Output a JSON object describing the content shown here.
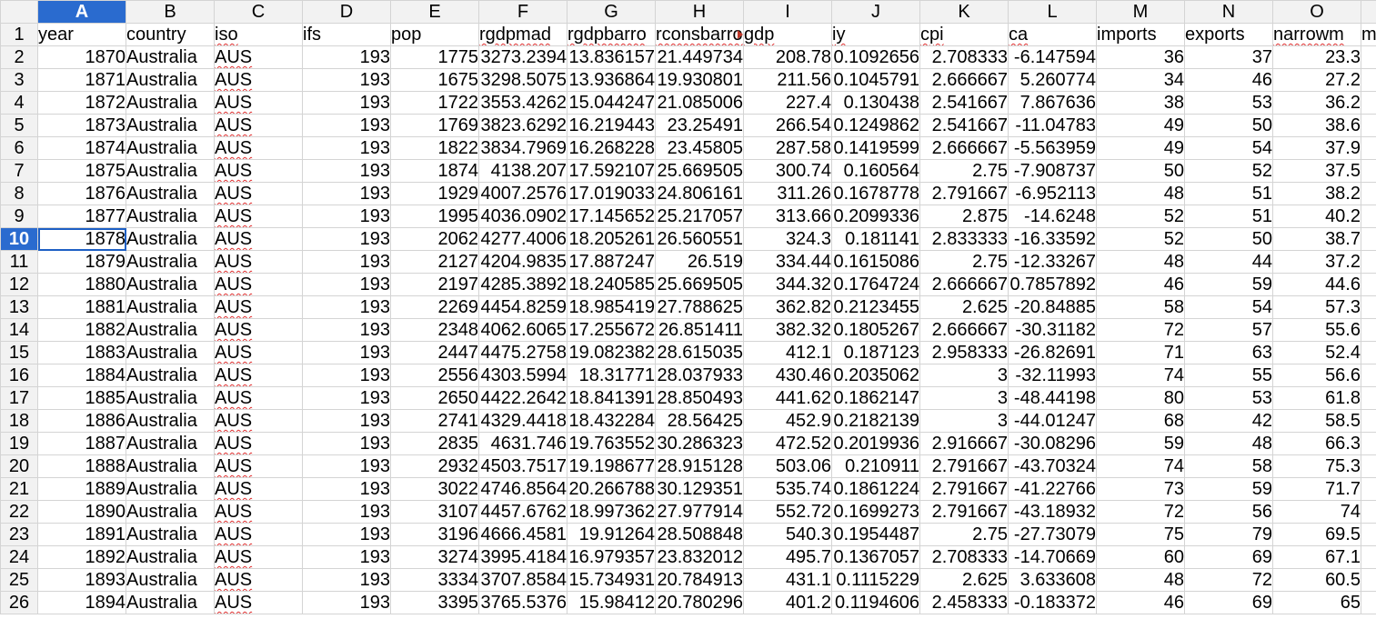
{
  "column_letters": [
    "A",
    "B",
    "C",
    "D",
    "E",
    "F",
    "G",
    "H",
    "I",
    "J",
    "K",
    "L",
    "M",
    "N",
    "O",
    ""
  ],
  "active_column": "A",
  "active_row": 10,
  "header_row": [
    "year",
    "country",
    "iso",
    "ifs",
    "pop",
    "rgdpmad",
    "rgdpbarro",
    "rconsbarro",
    "gdp",
    "iy",
    "cpi",
    "ca",
    "imports",
    "exports",
    "narrowm",
    "m"
  ],
  "rows": [
    [
      "1870",
      "Australia",
      "AUS",
      "193",
      "1775",
      "3273.2394",
      "13.836157",
      "21.449734",
      "208.78",
      "0.1092656",
      "2.708333",
      "-6.147594",
      "36",
      "37",
      "23.3"
    ],
    [
      "1871",
      "Australia",
      "AUS",
      "193",
      "1675",
      "3298.5075",
      "13.936864",
      "19.930801",
      "211.56",
      "0.1045791",
      "2.666667",
      "5.260774",
      "34",
      "46",
      "27.2"
    ],
    [
      "1872",
      "Australia",
      "AUS",
      "193",
      "1722",
      "3553.4262",
      "15.044247",
      "21.085006",
      "227.4",
      "0.130438",
      "2.541667",
      "7.867636",
      "38",
      "53",
      "36.2"
    ],
    [
      "1873",
      "Australia",
      "AUS",
      "193",
      "1769",
      "3823.6292",
      "16.219443",
      "23.25491",
      "266.54",
      "0.1249862",
      "2.541667",
      "-11.04783",
      "49",
      "50",
      "38.6"
    ],
    [
      "1874",
      "Australia",
      "AUS",
      "193",
      "1822",
      "3834.7969",
      "16.268228",
      "23.45805",
      "287.58",
      "0.1419599",
      "2.666667",
      "-5.563959",
      "49",
      "54",
      "37.9"
    ],
    [
      "1875",
      "Australia",
      "AUS",
      "193",
      "1874",
      "4138.207",
      "17.592107",
      "25.669505",
      "300.74",
      "0.160564",
      "2.75",
      "-7.908737",
      "50",
      "52",
      "37.5"
    ],
    [
      "1876",
      "Australia",
      "AUS",
      "193",
      "1929",
      "4007.2576",
      "17.019033",
      "24.806161",
      "311.26",
      "0.1678778",
      "2.791667",
      "-6.952113",
      "48",
      "51",
      "38.2"
    ],
    [
      "1877",
      "Australia",
      "AUS",
      "193",
      "1995",
      "4036.0902",
      "17.145652",
      "25.217057",
      "313.66",
      "0.2099336",
      "2.875",
      "-14.6248",
      "52",
      "51",
      "40.2"
    ],
    [
      "1878",
      "Australia",
      "AUS",
      "193",
      "2062",
      "4277.4006",
      "18.205261",
      "26.560551",
      "324.3",
      "0.181141",
      "2.833333",
      "-16.33592",
      "52",
      "50",
      "38.7"
    ],
    [
      "1879",
      "Australia",
      "AUS",
      "193",
      "2127",
      "4204.9835",
      "17.887247",
      "26.519",
      "334.44",
      "0.1615086",
      "2.75",
      "-12.33267",
      "48",
      "44",
      "37.2"
    ],
    [
      "1880",
      "Australia",
      "AUS",
      "193",
      "2197",
      "4285.3892",
      "18.240585",
      "25.669505",
      "344.32",
      "0.1764724",
      "2.666667",
      "0.7857892",
      "46",
      "59",
      "44.6"
    ],
    [
      "1881",
      "Australia",
      "AUS",
      "193",
      "2269",
      "4454.8259",
      "18.985419",
      "27.788625",
      "362.82",
      "0.2123455",
      "2.625",
      "-20.84885",
      "58",
      "54",
      "57.3"
    ],
    [
      "1882",
      "Australia",
      "AUS",
      "193",
      "2348",
      "4062.6065",
      "17.255672",
      "26.851411",
      "382.32",
      "0.1805267",
      "2.666667",
      "-30.31182",
      "72",
      "57",
      "55.6"
    ],
    [
      "1883",
      "Australia",
      "AUS",
      "193",
      "2447",
      "4475.2758",
      "19.082382",
      "28.615035",
      "412.1",
      "0.187123",
      "2.958333",
      "-26.82691",
      "71",
      "63",
      "52.4"
    ],
    [
      "1884",
      "Australia",
      "AUS",
      "193",
      "2556",
      "4303.5994",
      "18.31771",
      "28.037933",
      "430.46",
      "0.2035062",
      "3",
      "-32.11993",
      "74",
      "55",
      "56.6"
    ],
    [
      "1885",
      "Australia",
      "AUS",
      "193",
      "2650",
      "4422.2642",
      "18.841391",
      "28.850493",
      "441.62",
      "0.1862147",
      "3",
      "-48.44198",
      "80",
      "53",
      "61.8"
    ],
    [
      "1886",
      "Australia",
      "AUS",
      "193",
      "2741",
      "4329.4418",
      "18.432284",
      "28.56425",
      "452.9",
      "0.2182139",
      "3",
      "-44.01247",
      "68",
      "42",
      "58.5"
    ],
    [
      "1887",
      "Australia",
      "AUS",
      "193",
      "2835",
      "4631.746",
      "19.763552",
      "30.286323",
      "472.52",
      "0.2019936",
      "2.916667",
      "-30.08296",
      "59",
      "48",
      "66.3"
    ],
    [
      "1888",
      "Australia",
      "AUS",
      "193",
      "2932",
      "4503.7517",
      "19.198677",
      "28.915128",
      "503.06",
      "0.210911",
      "2.791667",
      "-43.70324",
      "74",
      "58",
      "75.3"
    ],
    [
      "1889",
      "Australia",
      "AUS",
      "193",
      "3022",
      "4746.8564",
      "20.266788",
      "30.129351",
      "535.74",
      "0.1861224",
      "2.791667",
      "-41.22766",
      "73",
      "59",
      "71.7"
    ],
    [
      "1890",
      "Australia",
      "AUS",
      "193",
      "3107",
      "4457.6762",
      "18.997362",
      "27.977914",
      "552.72",
      "0.1699273",
      "2.791667",
      "-43.18932",
      "72",
      "56",
      "74"
    ],
    [
      "1891",
      "Australia",
      "AUS",
      "193",
      "3196",
      "4666.4581",
      "19.91264",
      "28.508848",
      "540.3",
      "0.1954487",
      "2.75",
      "-27.73079",
      "75",
      "79",
      "69.5"
    ],
    [
      "1892",
      "Australia",
      "AUS",
      "193",
      "3274",
      "3995.4184",
      "16.979357",
      "23.832012",
      "495.7",
      "0.1367057",
      "2.708333",
      "-14.70669",
      "60",
      "69",
      "67.1"
    ],
    [
      "1893",
      "Australia",
      "AUS",
      "193",
      "3334",
      "3707.8584",
      "15.734931",
      "20.784913",
      "431.1",
      "0.1115229",
      "2.625",
      "3.633608",
      "48",
      "72",
      "60.5"
    ],
    [
      "1894",
      "Australia",
      "AUS",
      "193",
      "3395",
      "3765.5376",
      "15.98412",
      "20.780296",
      "401.2",
      "0.1194606",
      "2.458333",
      "-0.183372",
      "46",
      "69",
      "65"
    ]
  ],
  "colors": {
    "active_header_bg": "#2a6bcf",
    "header_bg": "#f2f2f2",
    "grid": "#d4d4d4",
    "spellcheck_underline": "#e03030"
  }
}
